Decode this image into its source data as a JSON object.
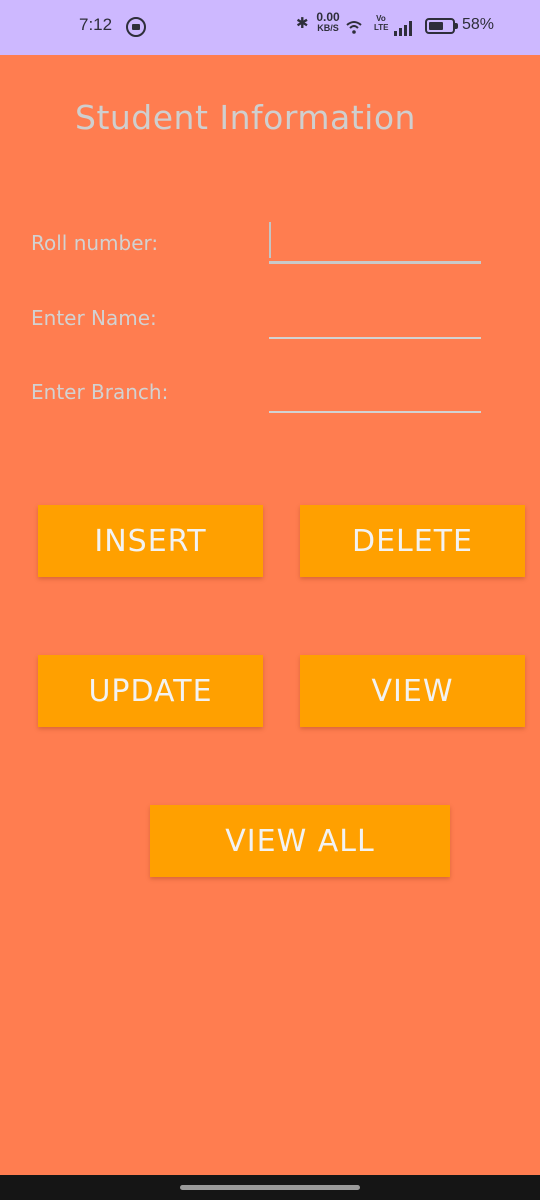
{
  "status_bar": {
    "time": "7:12",
    "network_speed_value": "0.00",
    "network_speed_unit": "KB/S",
    "volte_line1": "Vo",
    "volte_line2": "LTE",
    "battery_percent": "58%",
    "icons": [
      "notification-icon",
      "bluetooth-icon",
      "wifi-icon",
      "signal-icon",
      "battery-icon"
    ]
  },
  "page": {
    "title": "Student Information"
  },
  "form": {
    "fields": [
      {
        "label": "Roll number:",
        "value": "",
        "focused": true
      },
      {
        "label": "Enter Name:",
        "value": "",
        "focused": false
      },
      {
        "label": "Enter Branch:",
        "value": "",
        "focused": false
      }
    ]
  },
  "buttons": {
    "insert": "INSERT",
    "delete": "DELETE",
    "update": "UPDATE",
    "view": "VIEW",
    "view_all": "VIEW ALL"
  },
  "colors": {
    "background": "#ff7d50",
    "status_bar": "#cdb8ff",
    "button": "#ffa000",
    "text_muted": "#d2d2d2"
  }
}
